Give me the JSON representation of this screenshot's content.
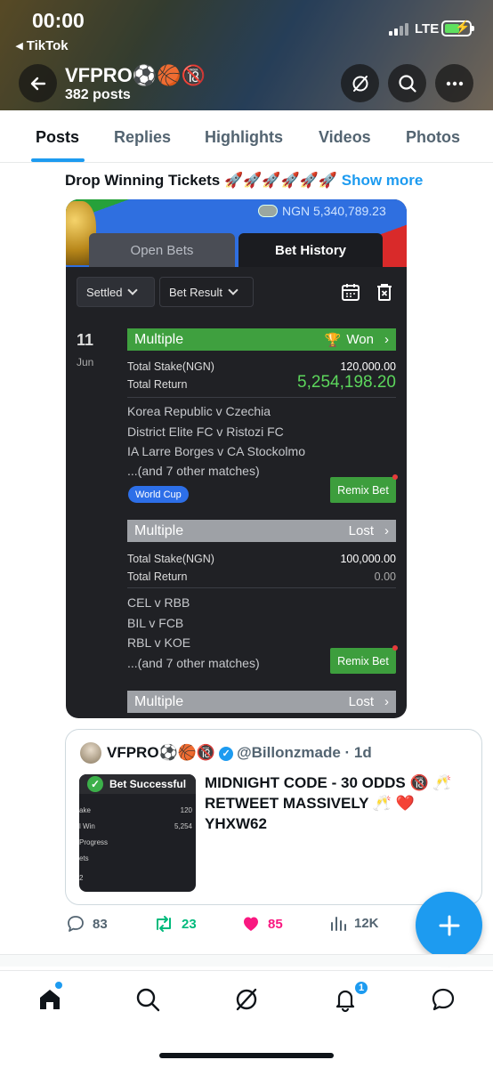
{
  "status_bar": {
    "time": "00:00",
    "back_app": "◂ TikTok",
    "network": "LTE"
  },
  "profile": {
    "name": "VFPRO⚽🏀🔞",
    "posts": "382 posts"
  },
  "tabs": [
    {
      "label": "Posts",
      "active": true
    },
    {
      "label": "Replies",
      "active": false
    },
    {
      "label": "Highlights",
      "active": false
    },
    {
      "label": "Videos",
      "active": false
    },
    {
      "label": "Photos",
      "active": false
    }
  ],
  "post": {
    "text": "Drop Winning Tickets 🚀🚀🚀🚀🚀🚀",
    "show_more": "Show more"
  },
  "bet_screenshot": {
    "balance": "NGN 5,340,789.23",
    "tabs": {
      "open": "Open Bets",
      "history": "Bet History"
    },
    "filters": {
      "settled": "Settled",
      "result": "Bet Result"
    },
    "date": {
      "day": "11",
      "month": "Jun"
    },
    "bets": [
      {
        "type": "Multiple",
        "status": "Won",
        "stake_label": "Total Stake(NGN)",
        "stake": "120,000.00",
        "return_label": "Total Return",
        "return": "5,254,198.20",
        "matches": [
          "Korea Republic v Czechia",
          "District Elite FC v Ristozi FC",
          "IA Larre Borges v CA Stockolmo",
          "...(and 7 other matches)"
        ],
        "badge": "World Cup",
        "remix": "Remix Bet"
      },
      {
        "type": "Multiple",
        "status": "Lost",
        "stake_label": "Total Stake(NGN)",
        "stake": "100,000.00",
        "return_label": "Total Return",
        "return": "0.00",
        "matches": [
          "CEL v RBB",
          "BIL v FCB",
          "RBL v KOE",
          "...(and 7 other matches)"
        ],
        "remix": "Remix Bet"
      },
      {
        "type": "Multiple",
        "status": "Lost"
      }
    ]
  },
  "quoted": {
    "name": "VFPRO⚽🏀🔞",
    "handle": "@Billonzmade · 1d",
    "thumb_title": "Bet Successful",
    "thumb_lines": [
      {
        "l": "ake",
        "r": "120"
      },
      {
        "l": "l Win",
        "r": "5,254"
      },
      {
        "l": "Progress",
        "r": ""
      },
      {
        "l": "ets",
        "r": ""
      },
      {
        "l": "2",
        "r": ""
      }
    ],
    "text": "MIDNIGHT CODE - 30 ODDS 🔞 🥂 RETWEET MASSIVELY 🥂 ❤️ YHXW62"
  },
  "actions": {
    "replies": "83",
    "reposts": "23",
    "likes": "85",
    "views": "12K"
  },
  "colors": {
    "accent": "#1d9bf0",
    "like": "#f91880",
    "repost": "#00ba7c",
    "won": "#3fa03f",
    "lost": "#9ea1a6"
  },
  "bottom_nav": {
    "notification_count": "1"
  }
}
